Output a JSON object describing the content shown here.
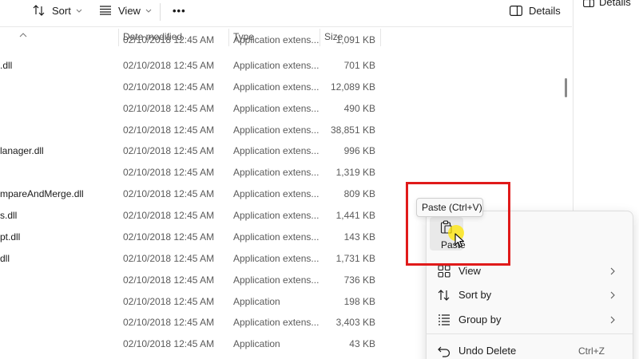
{
  "toolbar": {
    "sort_label": "Sort",
    "view_label": "View",
    "more_label": "•••",
    "details_label": "Details"
  },
  "right_pane": {
    "details_label": "Details"
  },
  "columns": {
    "date_modified": "Date modified",
    "type": "Type",
    "size": "Size"
  },
  "files": [
    {
      "name": "",
      "date": "02/10/2018 12:45 AM",
      "type": "Application extens...",
      "size": "1,091 KB"
    },
    {
      "name": ".dll",
      "date": "02/10/2018 12:45 AM",
      "type": "Application extens...",
      "size": "701 KB"
    },
    {
      "name": "",
      "date": "02/10/2018 12:45 AM",
      "type": "Application extens...",
      "size": "12,089 KB"
    },
    {
      "name": "",
      "date": "02/10/2018 12:45 AM",
      "type": "Application extens...",
      "size": "490 KB"
    },
    {
      "name": "",
      "date": "02/10/2018 12:45 AM",
      "type": "Application extens...",
      "size": "38,851 KB"
    },
    {
      "name": "lanager.dll",
      "date": "02/10/2018 12:45 AM",
      "type": "Application extens...",
      "size": "996 KB"
    },
    {
      "name": "",
      "date": "02/10/2018 12:45 AM",
      "type": "Application extens...",
      "size": "1,319 KB"
    },
    {
      "name": "mpareAndMerge.dll",
      "date": "02/10/2018 12:45 AM",
      "type": "Application extens...",
      "size": "809 KB"
    },
    {
      "name": "s.dll",
      "date": "02/10/2018 12:45 AM",
      "type": "Application extens...",
      "size": "1,441 KB"
    },
    {
      "name": "pt.dll",
      "date": "02/10/2018 12:45 AM",
      "type": "Application extens...",
      "size": "143 KB"
    },
    {
      "name": "dll",
      "date": "02/10/2018 12:45 AM",
      "type": "Application extens...",
      "size": "1,731 KB"
    },
    {
      "name": "",
      "date": "02/10/2018 12:45 AM",
      "type": "Application extens...",
      "size": "736 KB"
    },
    {
      "name": "",
      "date": "02/10/2018 12:45 AM",
      "type": "Application",
      "size": "198 KB"
    },
    {
      "name": "",
      "date": "02/10/2018 12:45 AM",
      "type": "Application extens...",
      "size": "3,403 KB"
    },
    {
      "name": "",
      "date": "02/10/2018 12:45 AM",
      "type": "Application",
      "size": "43 KB"
    }
  ],
  "context_menu": {
    "tooltip": "Paste (Ctrl+V)",
    "paste_label": "Paste",
    "view_label": "View",
    "sort_by_label": "Sort by",
    "group_by_label": "Group by",
    "undo_delete_label": "Undo Delete",
    "undo_delete_shortcut": "Ctrl+Z"
  },
  "colors": {
    "highlight": "#e01a1a",
    "cursor_glow": "#ffe600",
    "menu_bg": "#f9f9f9"
  }
}
